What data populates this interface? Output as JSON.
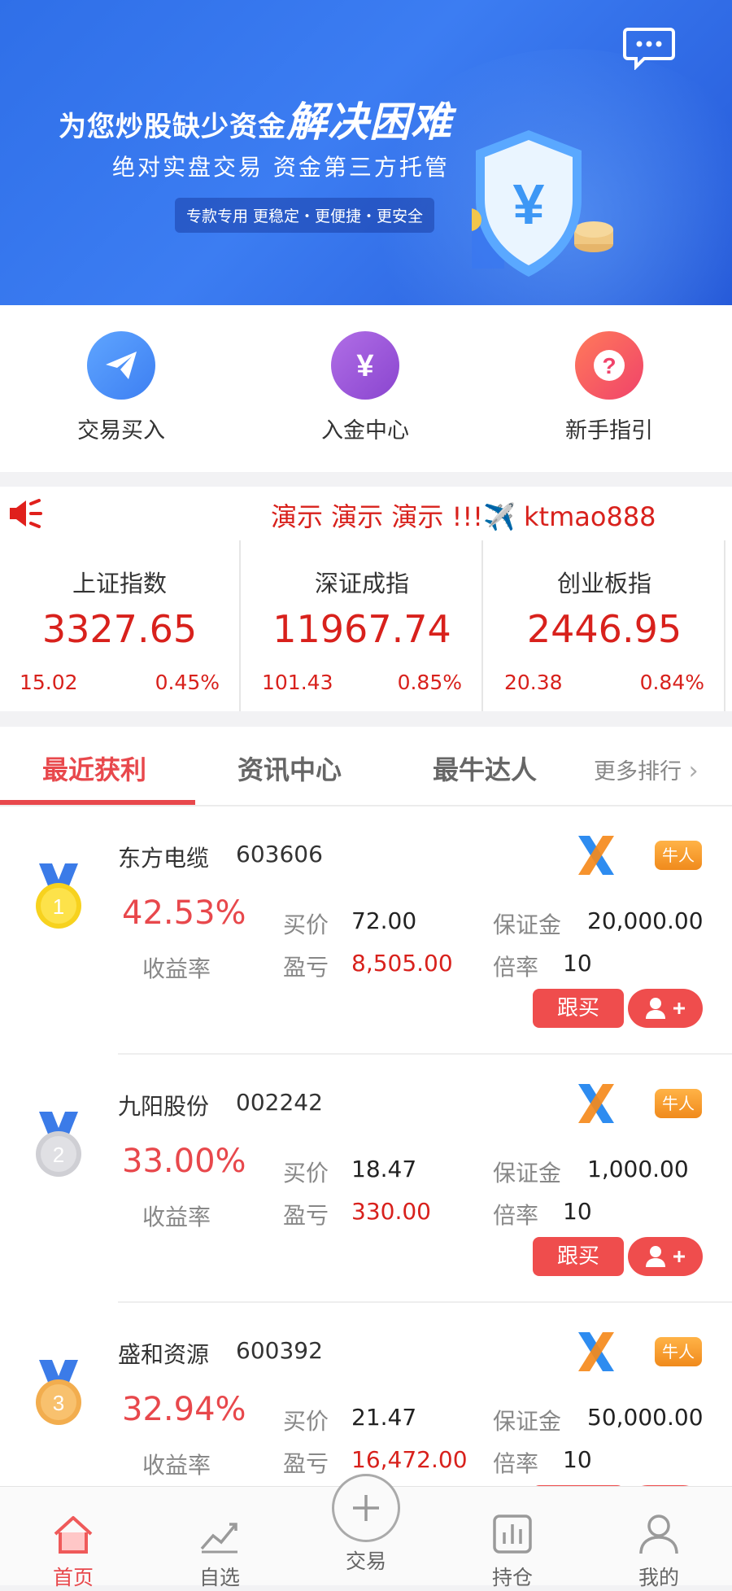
{
  "banner": {
    "title_main": "为您炒股缺少资金",
    "title_big": "解决困难",
    "subtitle": "绝对实盘交易  资金第三方托管",
    "pill": "专款专用  更稳定・更便捷・更安全",
    "shield_char": "¥",
    "message_icon": "message-bubble-icon"
  },
  "quick_actions": [
    {
      "label": "交易买入",
      "icon": "paper-plane-icon",
      "color": "#4f8ff7"
    },
    {
      "label": "入金中心",
      "icon": "yen-icon",
      "color": "#9a55d6"
    },
    {
      "label": "新手指引",
      "icon": "question-icon",
      "color": "#f25c5c"
    }
  ],
  "notice": {
    "text": "演示 演示 演示 !!!✈️ ktmao888",
    "icon": "speaker-icon"
  },
  "indices": [
    {
      "name": "上证指数",
      "value": "3327.65",
      "change": "15.02",
      "pct": "0.45%"
    },
    {
      "name": "深证成指",
      "value": "11967.74",
      "change": "101.43",
      "pct": "0.85%"
    },
    {
      "name": "创业板指",
      "value": "2446.95",
      "change": "20.38",
      "pct": "0.84%"
    }
  ],
  "tabs": {
    "items": [
      "最近获利",
      "资讯中心",
      "最牛达人"
    ],
    "active": "最近获利",
    "more": "更多排行"
  },
  "list": {
    "labels": {
      "rate": "收益率",
      "buy_price": "买价",
      "pnl": "盈亏",
      "margin": "保证金",
      "multiple": "倍率",
      "follow": "跟买",
      "badge": "牛人"
    },
    "items": [
      {
        "rank": "1",
        "name": "东方电缆",
        "code": "603606",
        "rate": "42.53%",
        "buy_price": "72.00",
        "pnl": "8,505.00",
        "margin": "20,000.00",
        "multiple": "10",
        "medal": "gold"
      },
      {
        "rank": "2",
        "name": "九阳股份",
        "code": "002242",
        "rate": "33.00%",
        "buy_price": "18.47",
        "pnl": "330.00",
        "margin": "1,000.00",
        "multiple": "10",
        "medal": "silver"
      },
      {
        "rank": "3",
        "name": "盛和资源",
        "code": "600392",
        "rate": "32.94%",
        "buy_price": "21.47",
        "pnl": "16,472.00",
        "margin": "50,000.00",
        "multiple": "10",
        "medal": "bronze"
      }
    ]
  },
  "bottom_nav": [
    {
      "label": "首页",
      "icon": "home-icon",
      "active": true
    },
    {
      "label": "自选",
      "icon": "trend-chart-icon",
      "active": false
    },
    {
      "label": "交易",
      "icon": "plus-circle-icon",
      "active": false
    },
    {
      "label": "持仓",
      "icon": "bar-chart-icon",
      "active": false
    },
    {
      "label": "我的",
      "icon": "user-icon",
      "active": false
    }
  ],
  "colors": {
    "accent_red": "#e8484c",
    "price_red": "#d8211c",
    "banner_blue": "#2f6fe8"
  }
}
